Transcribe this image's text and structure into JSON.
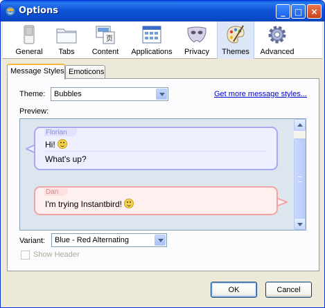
{
  "window": {
    "title": "Options"
  },
  "title_buttons": {
    "minimize": "_",
    "maximize": "□",
    "close": "×"
  },
  "panes": [
    {
      "id": "general",
      "label": "General",
      "icon": "switch-icon"
    },
    {
      "id": "tabs",
      "label": "Tabs",
      "icon": "tabs-folder-icon"
    },
    {
      "id": "content",
      "label": "Content",
      "icon": "content-icon"
    },
    {
      "id": "applications",
      "label": "Applications",
      "icon": "applications-icon"
    },
    {
      "id": "privacy",
      "label": "Privacy",
      "icon": "mask-icon"
    },
    {
      "id": "themes",
      "label": "Themes",
      "icon": "palette-icon",
      "selected": true
    },
    {
      "id": "advanced",
      "label": "Advanced",
      "icon": "gear-icon"
    }
  ],
  "tabs": [
    {
      "label": "Message Styles",
      "active": true
    },
    {
      "label": "Emoticons",
      "active": false
    }
  ],
  "theme": {
    "label": "Theme:",
    "value": "Bubbles",
    "more_link": "Get more message styles..."
  },
  "preview": {
    "label": "Preview:",
    "messages": [
      {
        "sender": "Florian",
        "color": "blue",
        "lines": [
          "Hi!",
          "What's up?"
        ],
        "emoticon_after_first": true
      },
      {
        "sender": "Dan",
        "color": "red",
        "lines": [
          "I'm trying Instantbird!"
        ],
        "emoticon_after_first": true
      }
    ]
  },
  "variant": {
    "label": "Variant:",
    "value": "Blue - Red Alternating"
  },
  "show_header": {
    "label": "Show Header",
    "checked": false,
    "enabled": false
  },
  "buttons": {
    "ok": "OK",
    "cancel": "Cancel"
  },
  "colors": {
    "titlebar": "#0a4ccb",
    "blue_bubble_border": "#a7a7f2",
    "red_bubble_border": "#f2a4a4",
    "link": "#0000cc"
  }
}
